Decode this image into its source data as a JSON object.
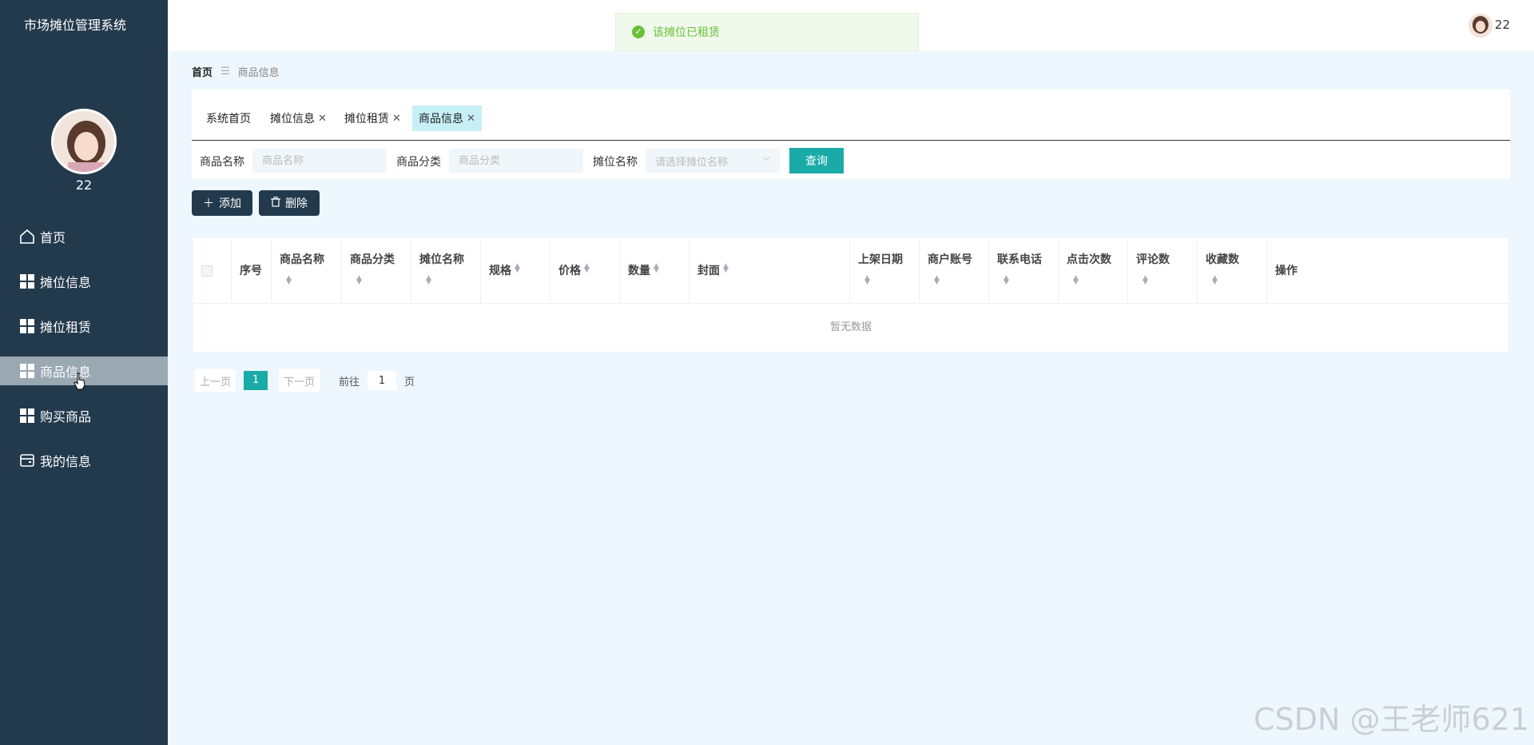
{
  "sidebar": {
    "app_title": "市场摊位管理系统",
    "username": "22",
    "items": [
      {
        "label": "首页",
        "icon": "home-icon"
      },
      {
        "label": "摊位信息",
        "icon": "grid-icon"
      },
      {
        "label": "摊位租赁",
        "icon": "grid-icon"
      },
      {
        "label": "商品信息",
        "icon": "grid-icon",
        "active": true
      },
      {
        "label": "购买商品",
        "icon": "grid-icon"
      },
      {
        "label": "我的信息",
        "icon": "wallet-icon"
      }
    ]
  },
  "header": {
    "toast": "该摊位已租赁",
    "username": "22"
  },
  "breadcrumb": {
    "home": "首页",
    "separator": "☰",
    "current": "商品信息"
  },
  "tabs": [
    {
      "label": "系统首页",
      "closable": false
    },
    {
      "label": "摊位信息",
      "closable": true
    },
    {
      "label": "摊位租赁",
      "closable": true
    },
    {
      "label": "商品信息",
      "closable": true,
      "active": true
    }
  ],
  "search": {
    "name_label": "商品名称",
    "name_placeholder": "商品名称",
    "category_label": "商品分类",
    "category_placeholder": "商品分类",
    "stall_label": "摊位名称",
    "stall_placeholder": "请选择摊位名称",
    "query_button": "查询"
  },
  "actions": {
    "add": "添加",
    "delete": "删除"
  },
  "table": {
    "columns": [
      "序号",
      "商品名称",
      "商品分类",
      "摊位名称",
      "规格",
      "价格",
      "数量",
      "封面",
      "上架日期",
      "商户账号",
      "联系电话",
      "点击次数",
      "评论数",
      "收藏数",
      "操作"
    ],
    "empty_text": "暂无数据"
  },
  "pagination": {
    "prev": "上一页",
    "current_page": "1",
    "next": "下一页",
    "goto_label": "前往",
    "goto_value": "1",
    "unit": "页"
  },
  "watermark": "CSDN @王老师621",
  "colors": {
    "sidebar": "#233a4d",
    "accent": "#1aaba8",
    "success": "#67c23a"
  }
}
